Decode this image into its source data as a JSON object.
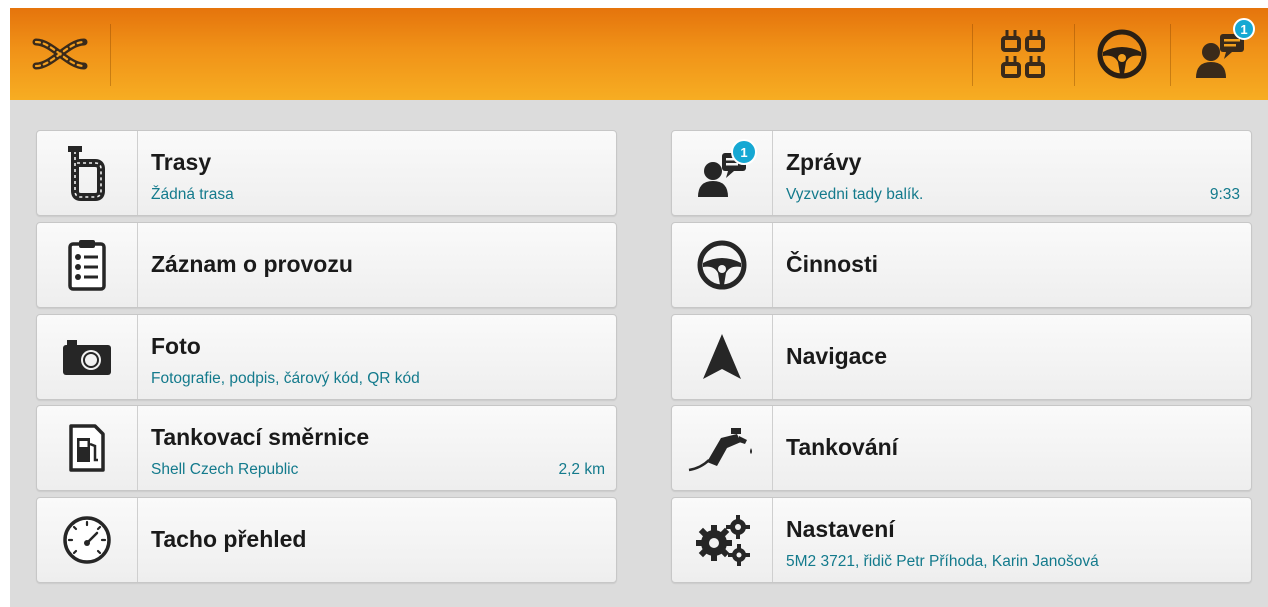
{
  "colors": {
    "topbar_gradient_top": "#e5740c",
    "topbar_gradient_bottom": "#f7ad22",
    "accent_text": "#137a8c",
    "badge": "#16a8d3",
    "background": "#dcdcdc"
  },
  "topbar": {
    "logo_icon": "crossed-roads-logo-icon",
    "actions": [
      {
        "icon": "multi-screen-icon"
      },
      {
        "icon": "steering-wheel-icon"
      },
      {
        "icon": "messages-icon",
        "badge": "1"
      }
    ]
  },
  "menu": {
    "left": [
      {
        "title": "Trasy",
        "subtitle": "Žádná trasa",
        "meta": "",
        "icon": "route-icon"
      },
      {
        "title": "Záznam o provozu",
        "subtitle": "",
        "meta": "",
        "icon": "clipboard-checklist-icon"
      },
      {
        "title": "Foto",
        "subtitle": "Fotografie, podpis, čárový kód, QR kód",
        "meta": "",
        "icon": "camera-icon"
      },
      {
        "title": "Tankovací směrnice",
        "subtitle": "Shell Czech Republic",
        "meta": "2,2 km",
        "icon": "fuel-station-document-icon"
      },
      {
        "title": "Tacho přehled",
        "subtitle": "",
        "meta": "",
        "icon": "tachograph-gauge-icon"
      }
    ],
    "right": [
      {
        "title": "Zprávy",
        "subtitle": "Vyzvedni tady balík.",
        "meta": "9:33",
        "icon": "messages-icon",
        "badge": "1"
      },
      {
        "title": "Činnosti",
        "subtitle": "",
        "meta": "",
        "icon": "steering-wheel-icon"
      },
      {
        "title": "Navigace",
        "subtitle": "",
        "meta": "",
        "icon": "navigation-arrow-icon"
      },
      {
        "title": "Tankování",
        "subtitle": "",
        "meta": "",
        "icon": "fuel-nozzle-icon"
      },
      {
        "title": "Nastavení",
        "subtitle": "5M2 3721, řidič Petr Příhoda, Karin Janošová",
        "meta": "",
        "icon": "gears-icon"
      }
    ]
  }
}
